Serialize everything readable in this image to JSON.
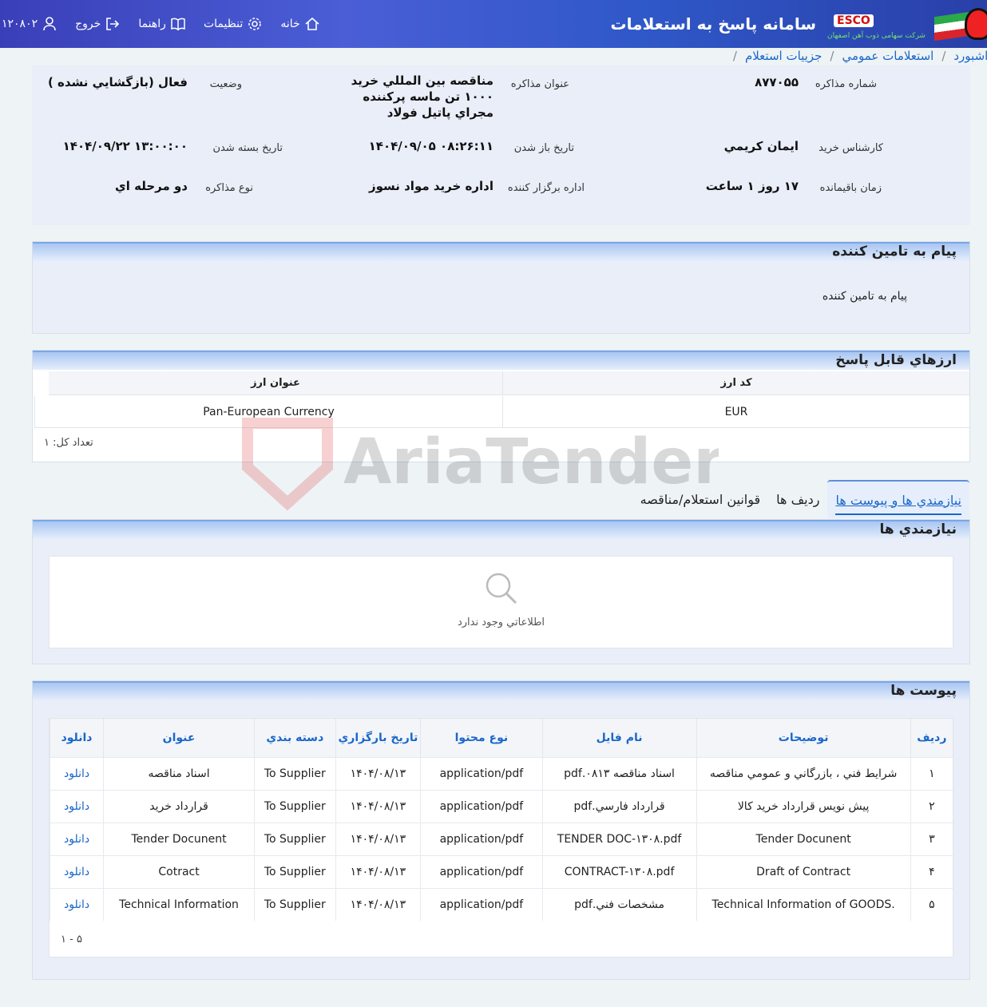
{
  "header": {
    "title": "سامانه پاسخ به استعلامات",
    "logo_text": "ESCO",
    "logo_subtitle": "شرکت سهامی ذوب آهن اصفهان",
    "nav": [
      {
        "label": "خانه",
        "icon": "home-icon"
      },
      {
        "label": "تنظيمات",
        "icon": "gear-icon"
      },
      {
        "label": "راهنما",
        "icon": "book-icon"
      },
      {
        "label": "خروج",
        "icon": "logout-icon"
      },
      {
        "label": "۱۲۰۸۰۲",
        "icon": "user-icon"
      }
    ]
  },
  "breadcrumb": [
    "داشبورد",
    "استعلامات عمومي",
    "جزييات استعلام"
  ],
  "details": {
    "number_label": "شماره مذاكره",
    "number": "۸۷۷۰۵۵",
    "title_label": "عنوان مذاكره",
    "title_line1": "مناقصه بين المللي خريد",
    "title_line2": "۱۰۰۰ تن ماسه پركننده",
    "title_line3": "مجراي پاتيل فولاد",
    "status_label": "وضعيت",
    "status": "فعال (بازگشايي نشده )",
    "expert_label": "كارشناس خريد",
    "expert": "ايمان كريمي",
    "open_label": "تاريخ باز شدن",
    "open": "۱۴۰۴/۰۹/۰۵ ۰۸:۲۶:۱۱",
    "close_label": "تاريخ بسته شدن",
    "close": "۱۴۰۴/۰۹/۲۲ ۱۳:۰۰:۰۰",
    "remain_label": "زمان باقيمانده",
    "remain": "۱۷ روز ۱ ساعت",
    "office_label": "اداره برگزار كننده",
    "office": "اداره خريد مواد نسوز",
    "type_label": "نوع مذاكره",
    "type": "دو مرحله اي"
  },
  "supplier_msg": {
    "heading": "پيام به تامين كننده",
    "body": "پيام به تامين كننده"
  },
  "currencies": {
    "heading": "ارزهاي قابل پاسخ",
    "col_code": "كد ارز",
    "col_title": "عنوان ارز",
    "rows": [
      {
        "code": "EUR",
        "title": "Pan-European Currency"
      }
    ],
    "total": "تعداد كل: ۱"
  },
  "tabs": [
    {
      "label": "نيازمندي ها و پيوست ها",
      "active": true
    },
    {
      "label": "رديف ها",
      "active": false
    },
    {
      "label": "قوانين استعلام/مناقصه",
      "active": false
    }
  ],
  "requirements": {
    "heading": "نيازمندي ها",
    "empty": "اطلاعاتي وجود ندارد"
  },
  "attachments": {
    "heading": "پيوست ها",
    "columns": [
      "رديف",
      "توضيحات",
      "نام فايل",
      "نوع محتوا",
      "تاريخ بارگزاري",
      "دسته بندي",
      "عنوان",
      "دانلود"
    ],
    "rows": [
      {
        "n": "۱",
        "desc": "شرايط فني ، بازرگاني و عمومي مناقصه",
        "file": "اسناد مناقصه ۰۸۱۳.pdf",
        "type": "application/pdf",
        "date": "۱۴۰۴/۰۸/۱۳",
        "cat": "To Supplier",
        "title": "اسناد مناقصه",
        "dl": "دانلود"
      },
      {
        "n": "۲",
        "desc": "پيش نويس قرارداد خريد كالا",
        "file": "قرارداد فارسي.pdf",
        "type": "application/pdf",
        "date": "۱۴۰۴/۰۸/۱۳",
        "cat": "To Supplier",
        "title": "قرارداد خريد",
        "dl": "دانلود"
      },
      {
        "n": "۳",
        "desc": "Tender Docunent",
        "file": "TENDER DOC-۱۳۰۸.pdf",
        "type": "application/pdf",
        "date": "۱۴۰۴/۰۸/۱۳",
        "cat": "To Supplier",
        "title": "Tender Docunent",
        "dl": "دانلود"
      },
      {
        "n": "۴",
        "desc": "Draft of Contract",
        "file": "CONTRACT-۱۳۰۸.pdf",
        "type": "application/pdf",
        "date": "۱۴۰۴/۰۸/۱۳",
        "cat": "To Supplier",
        "title": "Cotract",
        "dl": "دانلود"
      },
      {
        "n": "۵",
        "desc": ".Technical Information of GOODS",
        "file": "مشخصات فني.pdf",
        "type": "application/pdf",
        "date": "۱۴۰۴/۰۸/۱۳",
        "cat": "To Supplier",
        "title": "Technical Information",
        "dl": "دانلود"
      }
    ],
    "pager": "۱ - ۵"
  },
  "watermark": "AriaTender.neT",
  "colors": {
    "accent": "#1a67c9",
    "header": "#3a4fc4",
    "panel": "#e9eef8"
  }
}
